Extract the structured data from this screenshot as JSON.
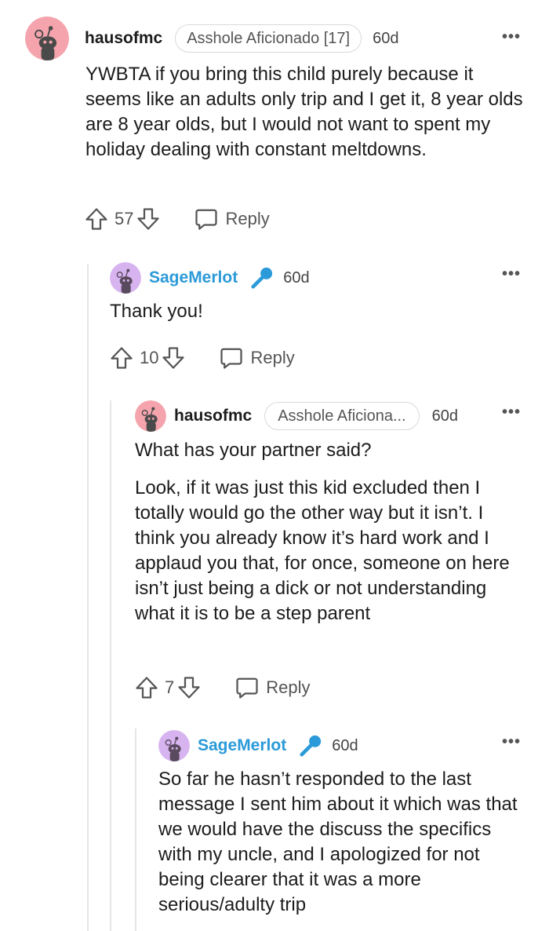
{
  "comments": [
    {
      "username": "hausofmc",
      "flair": "Asshole Aficionado [17]",
      "time": "60d",
      "body": [
        "YWBTA if you bring this child purely because it seems like an adults only trip and I get it, 8 year olds are 8 year olds, but I would not want to spent my holiday dealing with constant meltdowns."
      ],
      "votes": "57",
      "reply_label": "Reply",
      "more": "•••"
    },
    {
      "username": "SageMerlot",
      "time": "60d",
      "body": [
        "Thank you!"
      ],
      "votes": "10",
      "reply_label": "Reply",
      "more": "•••"
    },
    {
      "username": "hausofmc",
      "flair": "Asshole Aficiona...",
      "time": "60d",
      "body": [
        "What has your partner said?",
        "Look, if it was just this kid excluded then I totally would go the other way but it isn’t. I think you already know it’s hard work and I applaud you that, for once, someone on here isn’t just being a dick or not understanding what it is to be a step parent"
      ],
      "votes": "7",
      "reply_label": "Reply",
      "more": "•••"
    },
    {
      "username": "SageMerlot",
      "time": "60d",
      "body": [
        "So far he hasn’t responded to the last message I sent him about it which was that we would have the discuss the specifics with my uncle, and I apologized for not being clearer that it was a more serious/adulty trip"
      ],
      "votes": "",
      "reply_label": "",
      "more": "•••"
    }
  ],
  "colors": {
    "op_name": "#2b9ad8",
    "mic_icon": "#2b9ad8",
    "avatar_pink": "#f5a4ad",
    "avatar_purple": "#d7b4f0"
  },
  "icons": [
    "snoo-avatar-icon",
    "microphone-icon",
    "upvote-icon",
    "downvote-icon",
    "comment-bubble-icon",
    "more-options-icon"
  ]
}
